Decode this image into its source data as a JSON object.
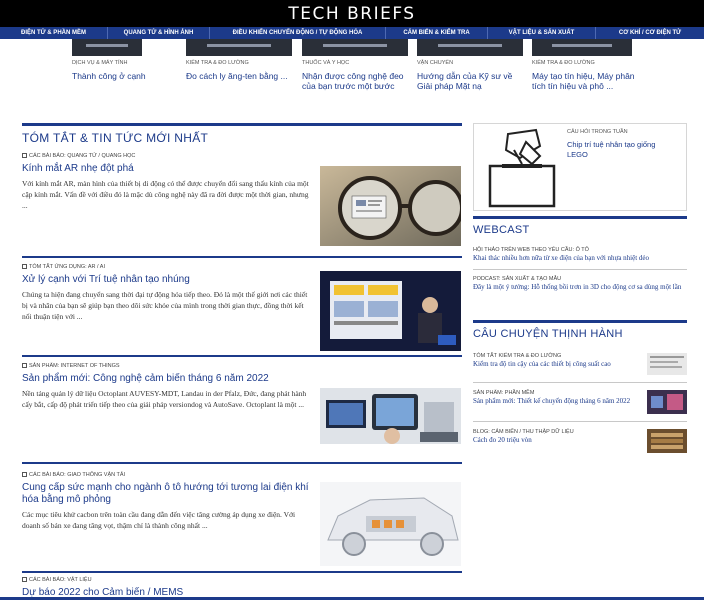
{
  "site": {
    "logo": "TECH BRIEFS"
  },
  "nav": [
    "ĐIỆN TỬ & PHẦN MỀM",
    "QUANG TỬ & HÌNH ẢNH",
    "ĐIỀU KHIỂN CHUYỂN ĐỘNG / TỰ ĐỘNG HÓA",
    "CẢM BIẾN & KIỂM TRA",
    "VẬT LIỆU & SẢN XUẤT",
    "CƠ KHÍ / CƠ ĐIỆN TỬ"
  ],
  "featured": [
    {
      "category": "DỊCH VỤ & MÁY TÍNH",
      "title": "Thành công ở cạnh"
    },
    {
      "category": "KIỂM TRA & ĐO LƯỜNG",
      "title": "Đo cách ly ăng-ten bằng ..."
    },
    {
      "category": "THUỐC VÀ Y HỌC",
      "title": "Nhận được công nghệ đeo của bạn trước một bước"
    },
    {
      "category": "VẬN CHUYỂN",
      "title": "Hướng dẫn của Kỹ sư về Giải pháp Mặt nạ"
    },
    {
      "category": "KIỂM TRA & ĐO LƯỜNG",
      "title": "Máy tạo tín hiệu, Máy phân tích tín hiệu và phô ..."
    }
  ],
  "main": {
    "heading": "TÓM TẮT & TIN TỨC MỚI NHẤT",
    "articles": [
      {
        "category": "CÁC BÀI BÁO: QUANG TỬ / QUANG HỌC",
        "title": "Kính mắt AR nhẹ đột phá",
        "desc": "Với kính mắt AR, màn hình của thiết bị di động có thể được chuyển đổi sang thấu kính của một cặp kính mắt. Vấn đề với điều đó là mặc dù công nghệ này đã ra đời được một thời gian, nhưng ..."
      },
      {
        "category": "TÓM TẮT ỨNG DỤNG: AR / AI",
        "title": "Xử lý cạnh với Trí tuệ nhân tạo nhúng",
        "desc": "Chúng ta hiện đang chuyển sang thời đại tự động hóa tiếp theo. Đó là một thế giới nơi các thiết bị và nhân của bạn sẽ giúp bạn theo dõi sức khỏe của mình trong thời gian thực, đồng thời kết nối thuận tiện với ..."
      },
      {
        "category": "SẢN PHẨM: INTERNET OF THINGS",
        "title": "Sản phẩm mới: Công nghệ cảm biến tháng 6 năm 2022",
        "desc": "Nền tảng quản lý dữ liệu Octoplant AUVESY-MDT, Landau in der Pfalz, Đức, đang phát hành cấy bắt, cấp độ phát triển tiếp theo của giải pháp versiondog và AutoSave. Octoplant là một ..."
      },
      {
        "category": "CÁC BÀI BÁO: GIAO THÔNG VẬN TẢI",
        "title": "Cung cấp sức mạnh cho ngành ô tô hướng tới tương lai điện khí hóa bằng mô phỏng",
        "desc": "Các mục tiêu khử cacbon trên toàn cầu đang dẫn đến việc tăng cường áp dụng xe điện. Với doanh số bán xe đang tăng vọt, thậm chí là thành công nhất ..."
      },
      {
        "category": "CÁC BÀI BÁO: VẬT LIỆU",
        "title": "Dự báo 2022 cho Cảm biến / MEMS",
        "desc": ""
      }
    ]
  },
  "side": {
    "question": {
      "label": "CÂU HỎI TRONG TUẦN",
      "title": "Chip trí tuệ nhân tạo giống LEGO"
    },
    "webcast": {
      "heading": "WEBCAST",
      "items": [
        {
          "category": "HỘI THẢO TRÊN WEB THEO YÊU CẦU: Ô TÔ",
          "title": "Khai thác nhiều hơn nữa từ xe điện của bạn với nhựa nhiệt dẻo"
        },
        {
          "category": "PODCAST: SẢN XUẤT & TẠO MẪU",
          "title": "Đây là một ý tưởng: Hỗ thống bồi trơn in 3D cho động cơ sa dùng một lần"
        }
      ]
    },
    "trending": {
      "heading": "CÂU CHUYỆN THỊNH HÀNH",
      "items": [
        {
          "category": "TÓM TẮT KIỂM TRA & ĐO LƯỜNG",
          "title": "Kiểm tra độ tin cậy của các thiết bị công suất cao"
        },
        {
          "category": "SẢN PHẨM: PHẦN MỀM",
          "title": "Sản phẩm mới: Thiết kế chuyển động tháng 6 năm 2022"
        },
        {
          "category": "BLOG: CẢM BIẾN / THU THẬP DỮ LIỆU",
          "title": "Cách đo 20 triệu vòn"
        }
      ]
    }
  },
  "colors": {
    "brand": "#1c3a8a",
    "nav_bg": "#1c3a8a",
    "top_bg": "#000000"
  }
}
